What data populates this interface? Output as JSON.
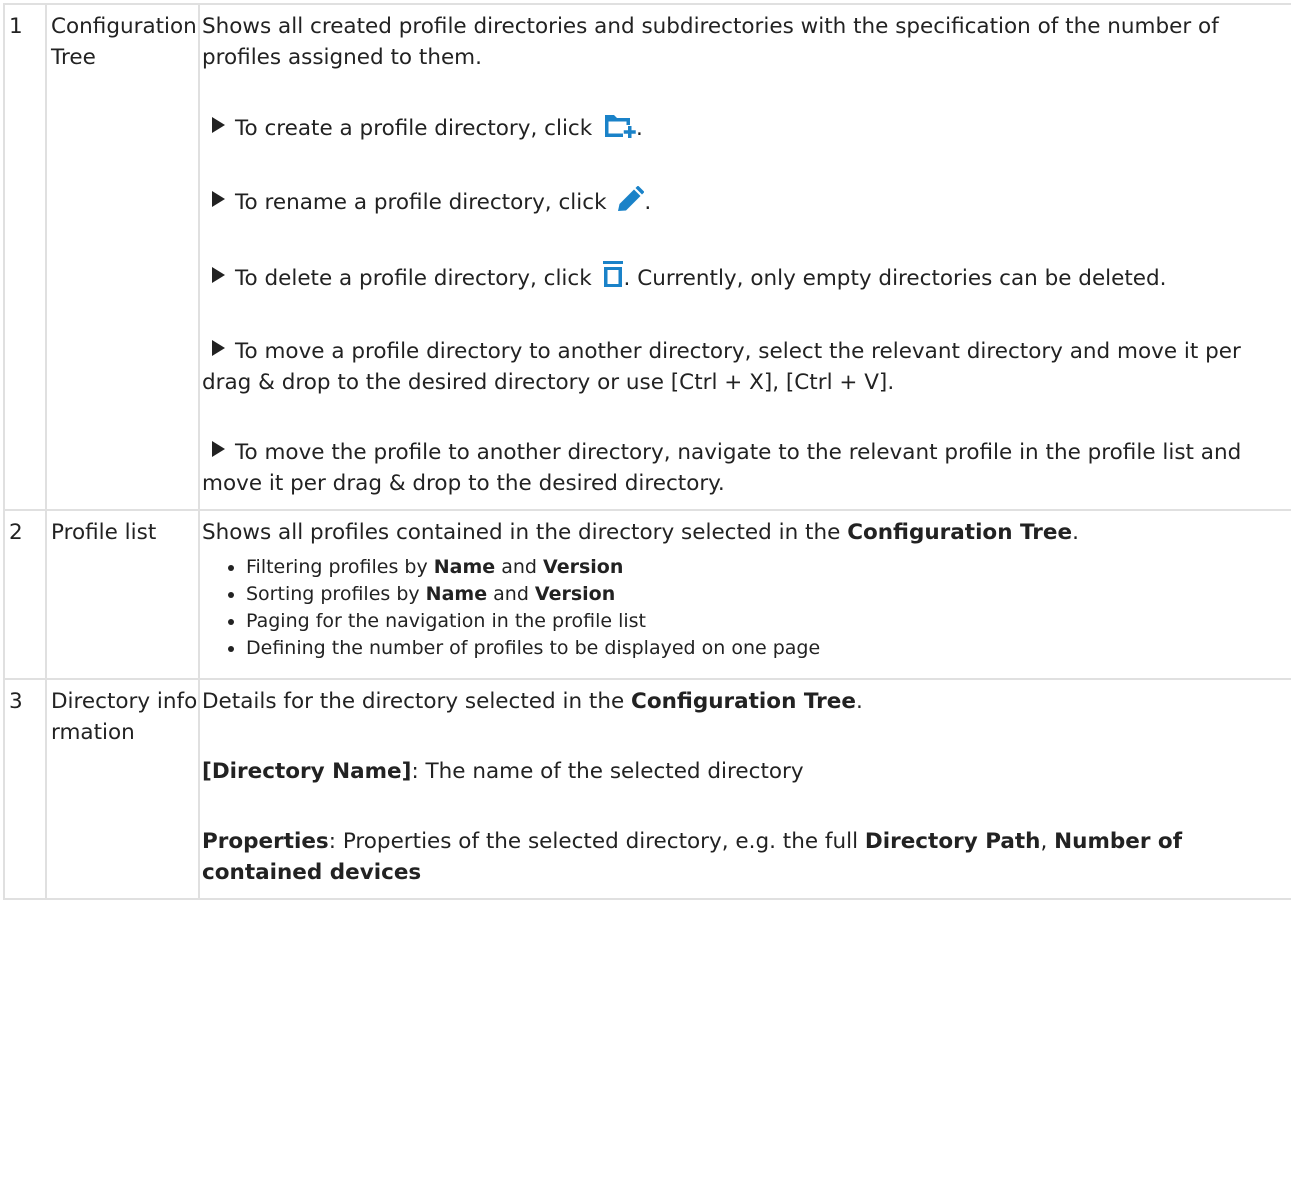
{
  "colors": {
    "icon": "#1a82c8",
    "border": "#e0e0e0",
    "text": "#222222"
  },
  "rows": [
    {
      "number": "1",
      "area": "Configuration Tree",
      "description": "Shows all created profile directories and subdirectories with the specification of the number of profiles assigned to them.",
      "steps": [
        {
          "text_before": "To create a profile directory, click ",
          "icon": "folder-add-icon",
          "text_after": "."
        },
        {
          "text_before": "To rename a profile directory, click ",
          "icon": "pencil-icon",
          "text_after": "."
        },
        {
          "text_before": "To delete a profile directory, click ",
          "icon": "trash-icon",
          "text_after": ". Currently, only empty directories can be deleted."
        },
        {
          "text": "To move a profile directory to another directory, select the relevant directory and move it per drag & drop to the desired directory or use [Ctrl + X], [Ctrl + V]."
        },
        {
          "text": "To move the profile to another directory, navigate to the relevant profile in the profile list and move it per drag & drop to the desired directory."
        }
      ]
    },
    {
      "number": "2",
      "area": "Profile list",
      "description_prefix": "Shows all profiles contained in the directory selected in the ",
      "description_bold": "Configuration Tree",
      "description_suffix": ".",
      "features": [
        {
          "pre": "Filtering profiles by ",
          "b1": "Name",
          "mid": " and ",
          "b2": "Version"
        },
        {
          "pre": "Sorting profiles by ",
          "b1": "Name",
          "mid": " and ",
          "b2": "Version"
        },
        {
          "text": "Paging for the navigation in the profile list"
        },
        {
          "text": "Defining the number of profiles to be displayed on one page"
        }
      ]
    },
    {
      "number": "3",
      "area": "Directory information",
      "description_prefix": "Details for the directory selected in the ",
      "description_bold": "Configuration Tree",
      "description_suffix": ".",
      "fields": [
        {
          "label": "[Directory Name]",
          "sep": ": ",
          "text": "The name of the selected directory"
        },
        {
          "label": "Properties",
          "sep": ": ",
          "text": "Properties of the selected directory, e.g. the full ",
          "bold1": "Directory Path",
          "comma": ", ",
          "bold2": "Number of contained devices"
        }
      ]
    }
  ]
}
